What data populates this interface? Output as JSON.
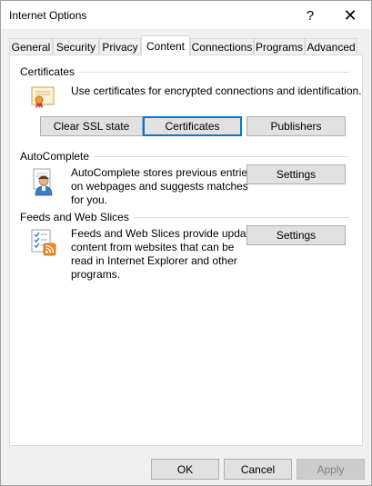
{
  "window": {
    "title": "Internet Options",
    "help_glyph": "?",
    "close_glyph": "✕"
  },
  "tabs": [
    {
      "label": "General"
    },
    {
      "label": "Security"
    },
    {
      "label": "Privacy"
    },
    {
      "label": "Content"
    },
    {
      "label": "Connections"
    },
    {
      "label": "Programs"
    },
    {
      "label": "Advanced"
    }
  ],
  "active_tab": "Content",
  "certificates": {
    "title": "Certificates",
    "description": "Use certificates for encrypted connections and identification.",
    "icon": "certificate-icon",
    "buttons": {
      "clear_ssl": "Clear SSL state",
      "certificates": "Certificates",
      "publishers": "Publishers"
    }
  },
  "autocomplete": {
    "title": "AutoComplete",
    "description_lines": [
      "AutoComplete stores previous entries",
      "on webpages and suggests matches",
      "for you."
    ],
    "icon": "autocomplete-user-icon",
    "settings_label": "Settings"
  },
  "feeds": {
    "title": "Feeds and Web Slices",
    "description_lines": [
      "Feeds and Web Slices provide updated",
      "content from websites that can be",
      "read in Internet Explorer and other",
      "programs."
    ],
    "icon": "feeds-rss-icon",
    "settings_label": "Settings"
  },
  "footer": {
    "ok": "OK",
    "cancel": "Cancel",
    "apply": "Apply"
  },
  "colors": {
    "focus_border": "#0078d7",
    "button_face": "#e1e1e1",
    "rss_orange": "#f08a24"
  }
}
